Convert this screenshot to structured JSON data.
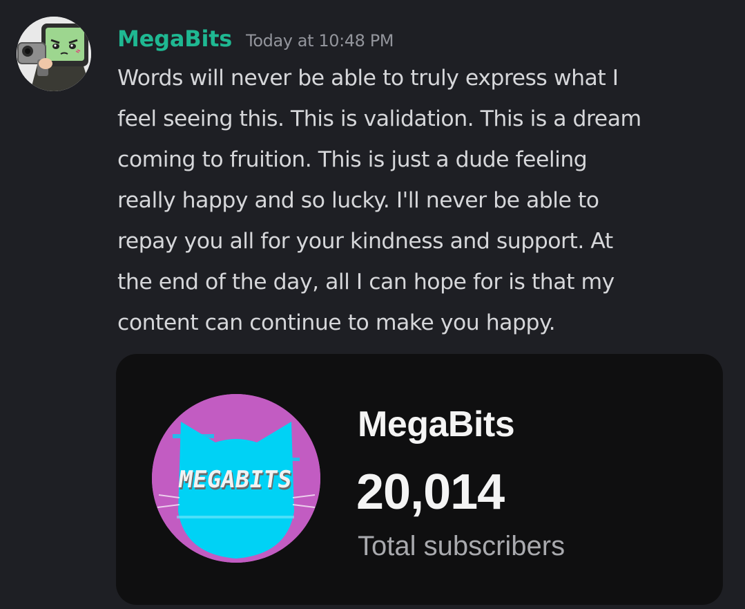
{
  "message": {
    "author": "MegaBits",
    "timestamp": "Today at 10:48 PM",
    "author_color": "#1fb892",
    "avatar_icon": "anime-character-with-gun-avatar",
    "lines": [
      "Words will never be able to truly express what I",
      "feel seeing this. This is validation. This is a dream",
      "coming to fruition. This is just a dude feeling",
      "really happy and so lucky. I'll never be able to",
      "repay you all for your kindness and support. At",
      "the end of the day, all I can hope for is that my",
      "content can continue to make you happy."
    ]
  },
  "embed": {
    "channel_name": "MegaBits",
    "subscriber_count": "20,014",
    "subscriber_label": "Total subscribers",
    "logo_text": "MEGABITS",
    "logo_icon": "cyan-cat-head-logo",
    "logo_colors": {
      "background": "#c25cc2",
      "cat": "#00d2f5"
    }
  }
}
